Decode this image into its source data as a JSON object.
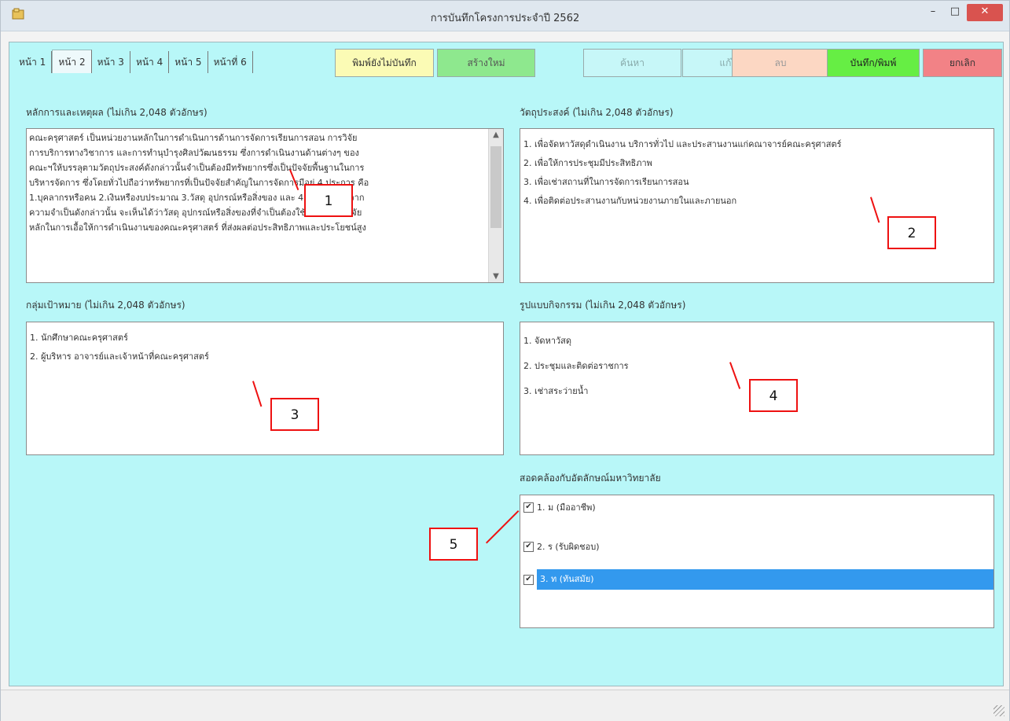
{
  "window": {
    "title": "การบันทึกโครงการประจำปี  2562",
    "minimize_label": "–",
    "maximize_label": "□",
    "close_label": "✕"
  },
  "tabs": [
    {
      "label": "หน้า 1",
      "active": false
    },
    {
      "label": "หน้า 2",
      "active": true
    },
    {
      "label": "หน้า 3",
      "active": false
    },
    {
      "label": "หน้า 4",
      "active": false
    },
    {
      "label": "หน้า 5",
      "active": false
    },
    {
      "label": "หน้าที่ 6",
      "active": false
    }
  ],
  "toolbar": {
    "print_unsaved_label": "พิมพ์ยังไม่บันทึก",
    "new_label": "สร้างใหม่",
    "search_label": "ค้นหา",
    "edit_label": "แก้ไข",
    "delete_label": "ลบ",
    "save_print_label": "บันทึก/พิมพ์",
    "cancel_label": "ยกเลิก"
  },
  "principles": {
    "label": "หลักการและเหตุผล (ไม่เกิน 2,048 ตัวอักษร)",
    "lines": [
      "คณะครุศาสตร์  เป็นหน่วยงานหลักในการดำเนินการด้านการจัดการเรียนการสอน การวิจัย",
      "การบริการทางวิชาการ และการทำนุบำรุงศิลปวัฒนธรรม  ซึ่งการดำเนินงานด้านต่างๆ ของ",
      "คณะฯให้บรรลุตามวัตถุประสงค์ดังกล่าวนั้นจำเป็นต้องมีทรัพยากรซึ่งเป็นปัจจัยพื้นฐานในการ",
      "บริหารจัดการ ซึ่งโดยทั่วไปถือว่าทรัพยากรที่เป็นปัจจัยสำคัญในการจัดการมีอยู่ 4 ประการ คือ",
      "1.บุคลากรหรือคน 2.เงินหรืองบประมาณ 3.วัสดุ อุปกรณ์หรือสิ่งของ และ 4.การจัดการ  จาก",
      "ความจำเป็นดังกล่าวนั้น จะเห็นได้ว่าวัสดุ อุปกรณ์หรือสิ่งของที่จำเป็นต้องใช้เป็น 1 ในปัจจัย",
      "หลักในการเอื้อให้การดำเนินงานของคณะครุศาสตร์ ที่ส่งผลต่อประสิทธิภาพและประโยชน์สูง"
    ]
  },
  "objectives": {
    "label": "วัตถุประสงค์ (ไม่เกิน 2,048 ตัวอักษร)",
    "lines": [
      "1. เพื่อจัดหาวัสดุดำเนินงาน บริการทั่วไป และประสานงานแก่คณาจารย์คณะครุศาสตร์",
      "2. เพื่อให้การประชุมมีประสิทธิภาพ",
      "3. เพื่อเช่าสถานที่ในการจัดการเรียนการสอน",
      "4. เพื่อติดต่อประสานงานกับหน่วยงานภายในและภายนอก"
    ]
  },
  "target_group": {
    "label": "กลุ่มเป้าหมาย (ไม่เกิน 2,048 ตัวอักษร)",
    "lines": [
      "1.  นักศึกษาคณะครุศาสตร์",
      "2.  ผู้บริหาร อาจารย์และเจ้าหน้าที่คณะครุศาสตร์"
    ]
  },
  "activity": {
    "label": "รูปแบบกิจกรรม (ไม่เกิน 2,048 ตัวอักษร)",
    "lines": [
      "1.  จัดหาวัสดุ",
      "2.  ประชุมและติดต่อราชการ",
      "3.  เช่าสระว่ายน้ำ"
    ]
  },
  "identity": {
    "label": "สอดคล้องกับอัตลักษณ์มหาวิทยาลัย",
    "items": [
      {
        "label": "1. ม (มืออาชีพ)",
        "checked": true,
        "selected": false
      },
      {
        "label": "2. ร (รับผิดชอบ)",
        "checked": true,
        "selected": false
      },
      {
        "label": "3. ท (ทันสมัย)",
        "checked": true,
        "selected": true
      }
    ]
  },
  "callouts": [
    "1",
    "2",
    "3",
    "4",
    "5"
  ],
  "check_mark": "✔",
  "scroll": {
    "up": "▲",
    "down": "▼"
  }
}
